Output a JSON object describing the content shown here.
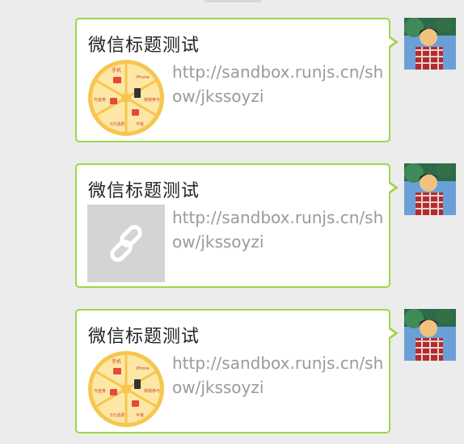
{
  "messages": [
    {
      "title": "微信标题测试",
      "description": "http://sandbox.runjs.cn/show/jkssoyzi",
      "thumbnail": "prize-wheel-image",
      "avatar": "user-avatar-photo"
    },
    {
      "title": "微信标题测试",
      "description": "http://sandbox.runjs.cn/show/jkssoyzi",
      "thumbnail": "link-icon-placeholder",
      "avatar": "user-avatar-photo"
    },
    {
      "title": "微信标题测试",
      "description": "http://sandbox.runjs.cn/show/jkssoyzi",
      "thumbnail": "prize-wheel-image",
      "avatar": "user-avatar-photo"
    }
  ],
  "wheel_labels": [
    "手机",
    "iPhone",
    "谢谢参与",
    "平板",
    "5元话费",
    "代金券"
  ],
  "colors": {
    "background": "#ececec",
    "bubble_border": "#9fd64a",
    "title_text": "#222222",
    "desc_text": "#9a9a9a",
    "placeholder_bg": "#d4d4d4",
    "wheel_yellow": "#f6c64e",
    "wheel_cream": "#fde7a6"
  }
}
